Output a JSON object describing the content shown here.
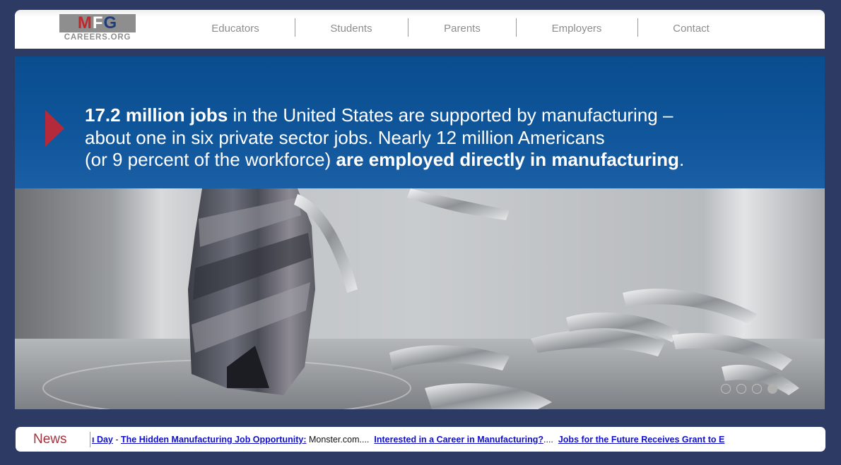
{
  "logo": {
    "main_m": "M",
    "main_f": "F",
    "main_g": "G",
    "sub": "CAREERS.ORG"
  },
  "nav": {
    "items": [
      {
        "label": "Educators"
      },
      {
        "label": "Students"
      },
      {
        "label": "Parents"
      },
      {
        "label": "Employers"
      },
      {
        "label": "Contact"
      }
    ]
  },
  "hero": {
    "line1_bold": "17.2 million jobs",
    "line1_rest": " in the United States are supported by manufacturing –",
    "line2": "about one in six private sector jobs. Nearly 12 million Americans",
    "line3_plain": "(or 9 percent of the workforce) ",
    "line3_bold": "are employed directly in manufacturing",
    "line3_end": ".",
    "image_alt": "carbide end mill cutting tool with aluminum chips",
    "slides_total": 5,
    "active_slide": 4
  },
  "news": {
    "label": "News",
    "ticker": {
      "item1_link": "ı Day",
      "sep1": " - ",
      "item2_link": "The Hidden Manufacturing Job Opportunity:",
      "item2_tail": " Monster.com....  ",
      "item3_link": "Interested in a Career in Manufacturing?",
      "item3_tail": "....  ",
      "item4_link": "Jobs for the Future Receives Grant to E"
    }
  },
  "colors": {
    "page_bg": "#2d3a64",
    "banner_blue": "#10569b",
    "accent_red": "#b52a3a",
    "news_label": "#a3333f",
    "link_blue": "#1010c8"
  }
}
